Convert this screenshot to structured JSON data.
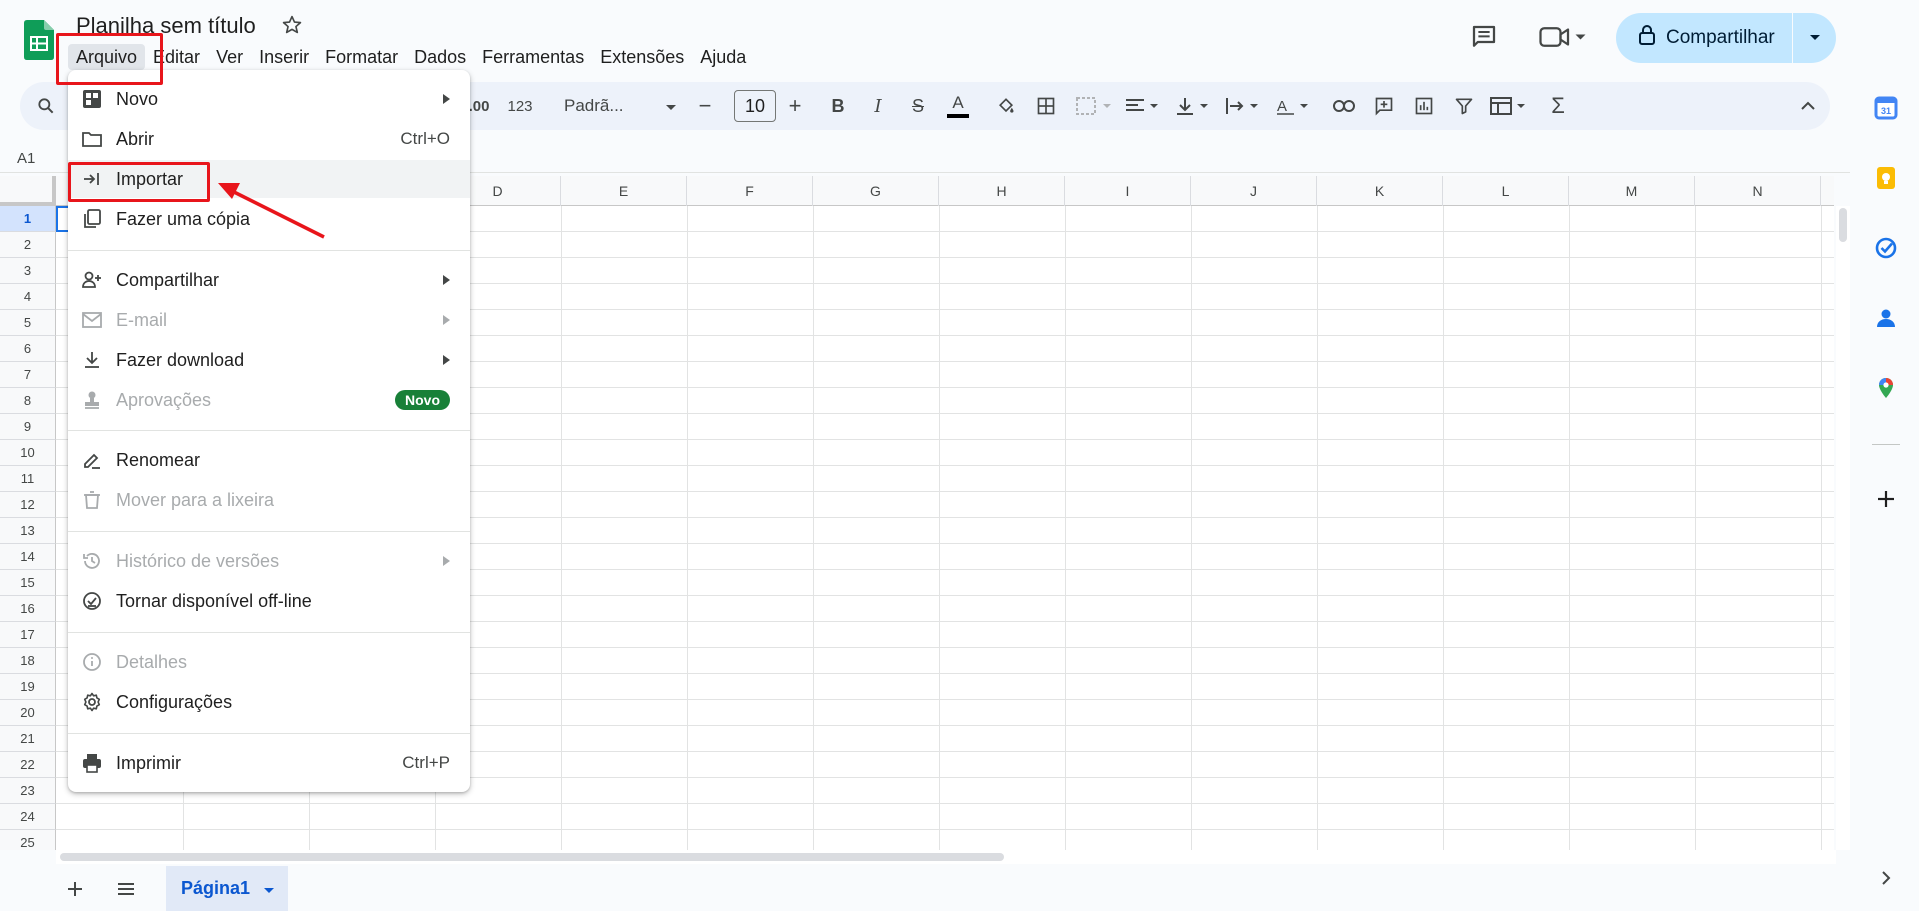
{
  "document": {
    "title": "Planilha sem título"
  },
  "menubar": {
    "items": [
      "Arquivo",
      "Editar",
      "Ver",
      "Inserir",
      "Formatar",
      "Dados",
      "Ferramentas",
      "Extensões",
      "Ajuda"
    ]
  },
  "header": {
    "share_label": "Compartilhar"
  },
  "toolbar": {
    "number_format_label": "123",
    "font_family": "Padrã...",
    "font_size": "10"
  },
  "namebox": {
    "cell_ref": "A1"
  },
  "grid": {
    "columns": [
      "D",
      "E",
      "F",
      "G",
      "H",
      "I",
      "J",
      "K",
      "L",
      "M",
      "N"
    ],
    "rows": [
      "1",
      "2",
      "3",
      "4",
      "5",
      "6",
      "7",
      "8",
      "9",
      "10",
      "11",
      "12",
      "13",
      "14",
      "15",
      "16",
      "17",
      "18",
      "19",
      "20",
      "21",
      "22",
      "23",
      "24",
      "25"
    ],
    "selected_row": "1"
  },
  "sheets": {
    "tabs": [
      "Página1"
    ]
  },
  "file_menu": {
    "items": [
      {
        "label": "Novo",
        "shortcut": "",
        "submenu": true,
        "disabled": false,
        "icon": "new-sheet-icon"
      },
      {
        "label": "Abrir",
        "shortcut": "Ctrl+O",
        "submenu": false,
        "disabled": false,
        "icon": "folder-icon"
      },
      {
        "label": "Importar",
        "shortcut": "",
        "submenu": false,
        "disabled": false,
        "icon": "import-icon"
      },
      {
        "label": "Fazer uma cópia",
        "shortcut": "",
        "submenu": false,
        "disabled": false,
        "icon": "copy-icon"
      },
      {
        "label": "Compartilhar",
        "shortcut": "",
        "submenu": true,
        "disabled": false,
        "icon": "person-add-icon"
      },
      {
        "label": "E-mail",
        "shortcut": "",
        "submenu": true,
        "disabled": true,
        "icon": "mail-icon"
      },
      {
        "label": "Fazer download",
        "shortcut": "",
        "submenu": true,
        "disabled": false,
        "icon": "download-icon"
      },
      {
        "label": "Aprovações",
        "badge": "Novo",
        "submenu": false,
        "disabled": true,
        "icon": "stamp-icon"
      },
      {
        "label": "Renomear",
        "shortcut": "",
        "submenu": false,
        "disabled": false,
        "icon": "rename-icon"
      },
      {
        "label": "Mover para a lixeira",
        "shortcut": "",
        "submenu": false,
        "disabled": true,
        "icon": "trash-icon"
      },
      {
        "label": "Histórico de versões",
        "shortcut": "",
        "submenu": true,
        "disabled": true,
        "icon": "history-icon"
      },
      {
        "label": "Tornar disponível off-line",
        "shortcut": "",
        "submenu": false,
        "disabled": false,
        "icon": "offline-icon"
      },
      {
        "label": "Detalhes",
        "shortcut": "",
        "submenu": false,
        "disabled": true,
        "icon": "info-icon"
      },
      {
        "label": "Configurações",
        "shortcut": "",
        "submenu": false,
        "disabled": false,
        "icon": "gear-icon"
      },
      {
        "label": "Imprimir",
        "shortcut": "Ctrl+P",
        "submenu": false,
        "disabled": false,
        "icon": "print-icon"
      }
    ],
    "hovered_item": "Importar"
  },
  "colors": {
    "accent": "#0b57d0",
    "share_button": "#c2e7ff",
    "annotation": "#e8151b",
    "badge_green": "#188038",
    "sheets_green": "#0f9d58"
  }
}
